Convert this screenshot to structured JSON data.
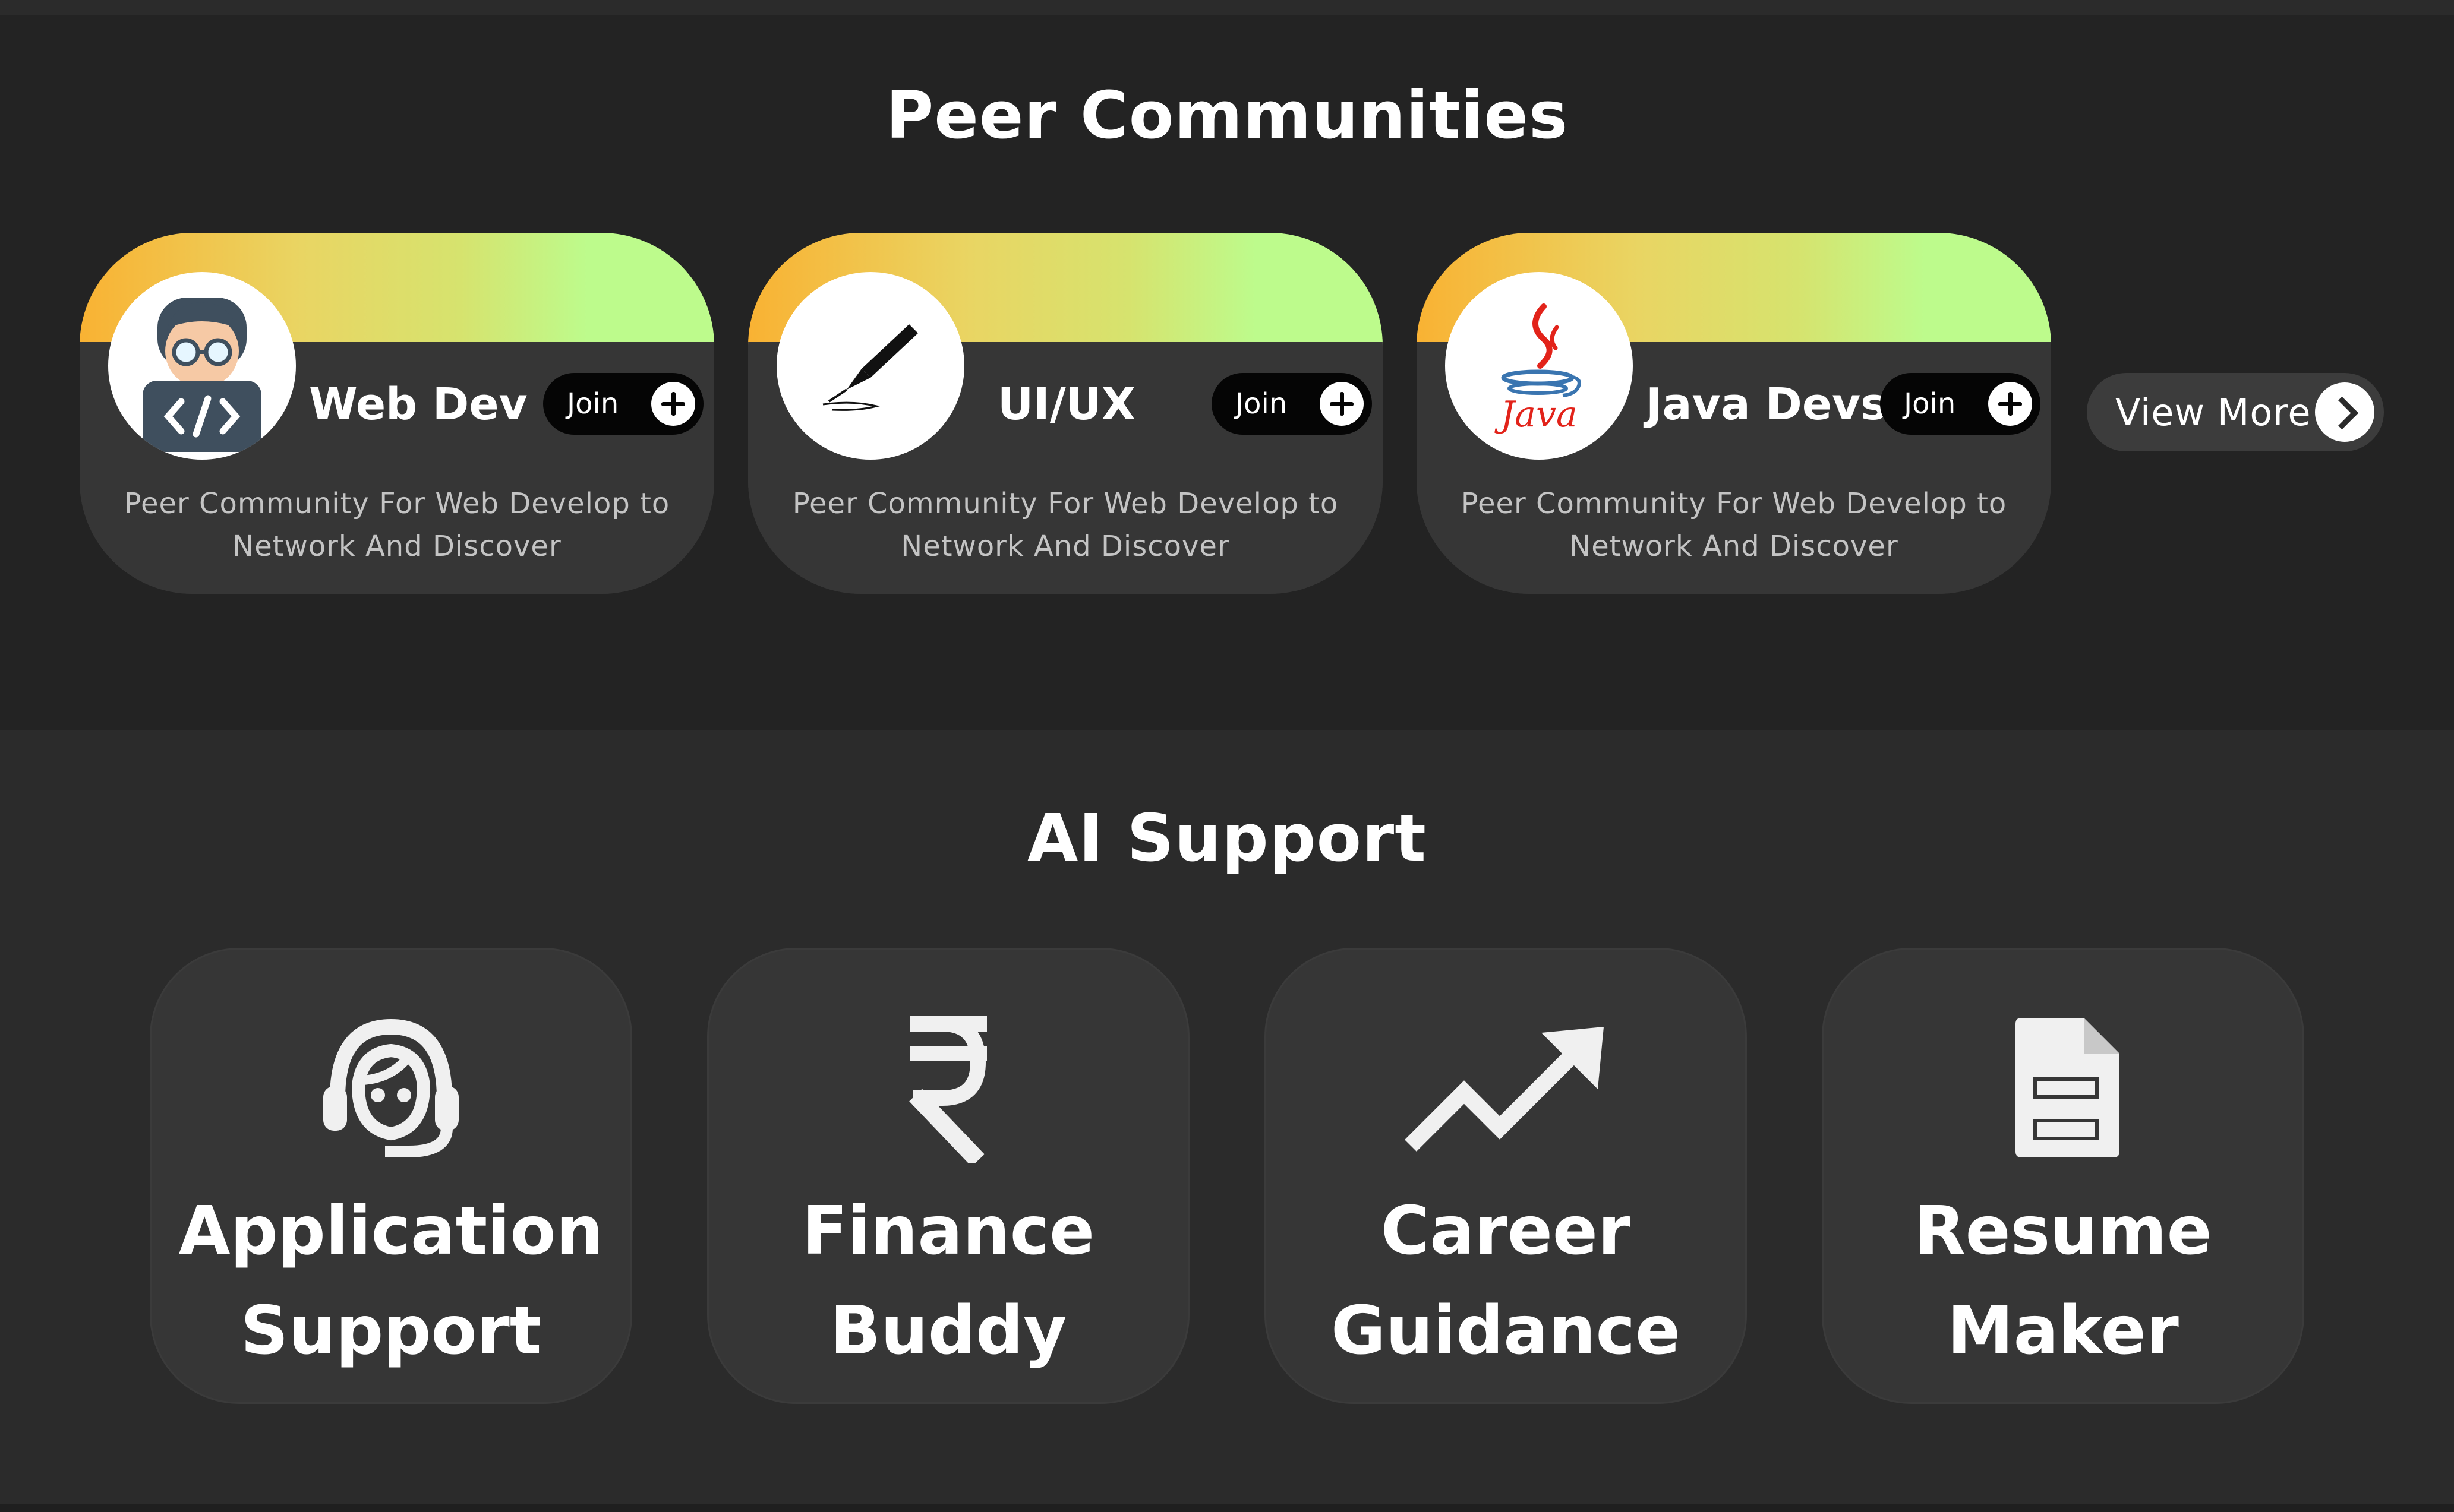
{
  "peer_communities": {
    "title": "Peer Communities",
    "cards": [
      {
        "name": "Web Dev",
        "join_label": "Join",
        "description": "Peer Community For Web Develop to Network And Discover",
        "avatar_icon": "web-developer-icon"
      },
      {
        "name": "UI/UX",
        "join_label": "Join",
        "description": "Peer Community For Web Develop to Network And Discover",
        "avatar_icon": "pen-nib-icon"
      },
      {
        "name": "Java Devs.",
        "join_label": "Join",
        "description": "Peer Community For Web Develop to Network And Discover",
        "avatar_icon": "java-logo-icon"
      }
    ],
    "view_more_label": "View More"
  },
  "ai_support": {
    "title": "AI Support",
    "tiles": [
      {
        "line1": "Application",
        "line2": "Support",
        "icon": "support-agent-icon"
      },
      {
        "line1": "Finance",
        "line2": "Buddy",
        "icon": "rupee-icon"
      },
      {
        "line1": "Career",
        "line2": "Guidance",
        "icon": "trending-up-icon"
      },
      {
        "line1": "Resume",
        "line2": "Maker",
        "icon": "document-icon"
      }
    ]
  },
  "colors": {
    "banner_start": "#f9b233",
    "banner_end": "#bdfb8c",
    "card_bg": "#363636",
    "section_dark": "#232323",
    "section_ai": "#2b2b2b"
  }
}
